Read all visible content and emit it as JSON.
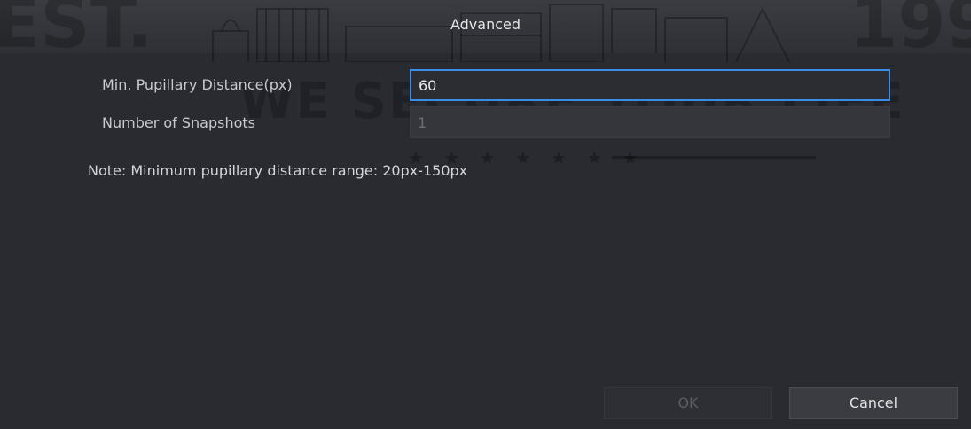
{
  "dialog": {
    "title": "Advanced"
  },
  "fields": [
    {
      "label": "Min. Pupillary Distance(px)",
      "value": "60",
      "state": "focused"
    },
    {
      "label": "Number of Snapshots",
      "value": "1",
      "state": "disabled"
    }
  ],
  "note": "Note: Minimum pupillary distance range: 20px-150px",
  "buttons": {
    "ok_label": "OK",
    "cancel_label": "Cancel"
  },
  "watermark": {
    "slogan": "WE SECURE YOUR LIFE",
    "corner_left": "EST.",
    "corner_right": "199"
  },
  "colors": {
    "dialog_bg": "#292b31",
    "focus_border": "#3a8ee6",
    "text": "#c9cacd"
  }
}
